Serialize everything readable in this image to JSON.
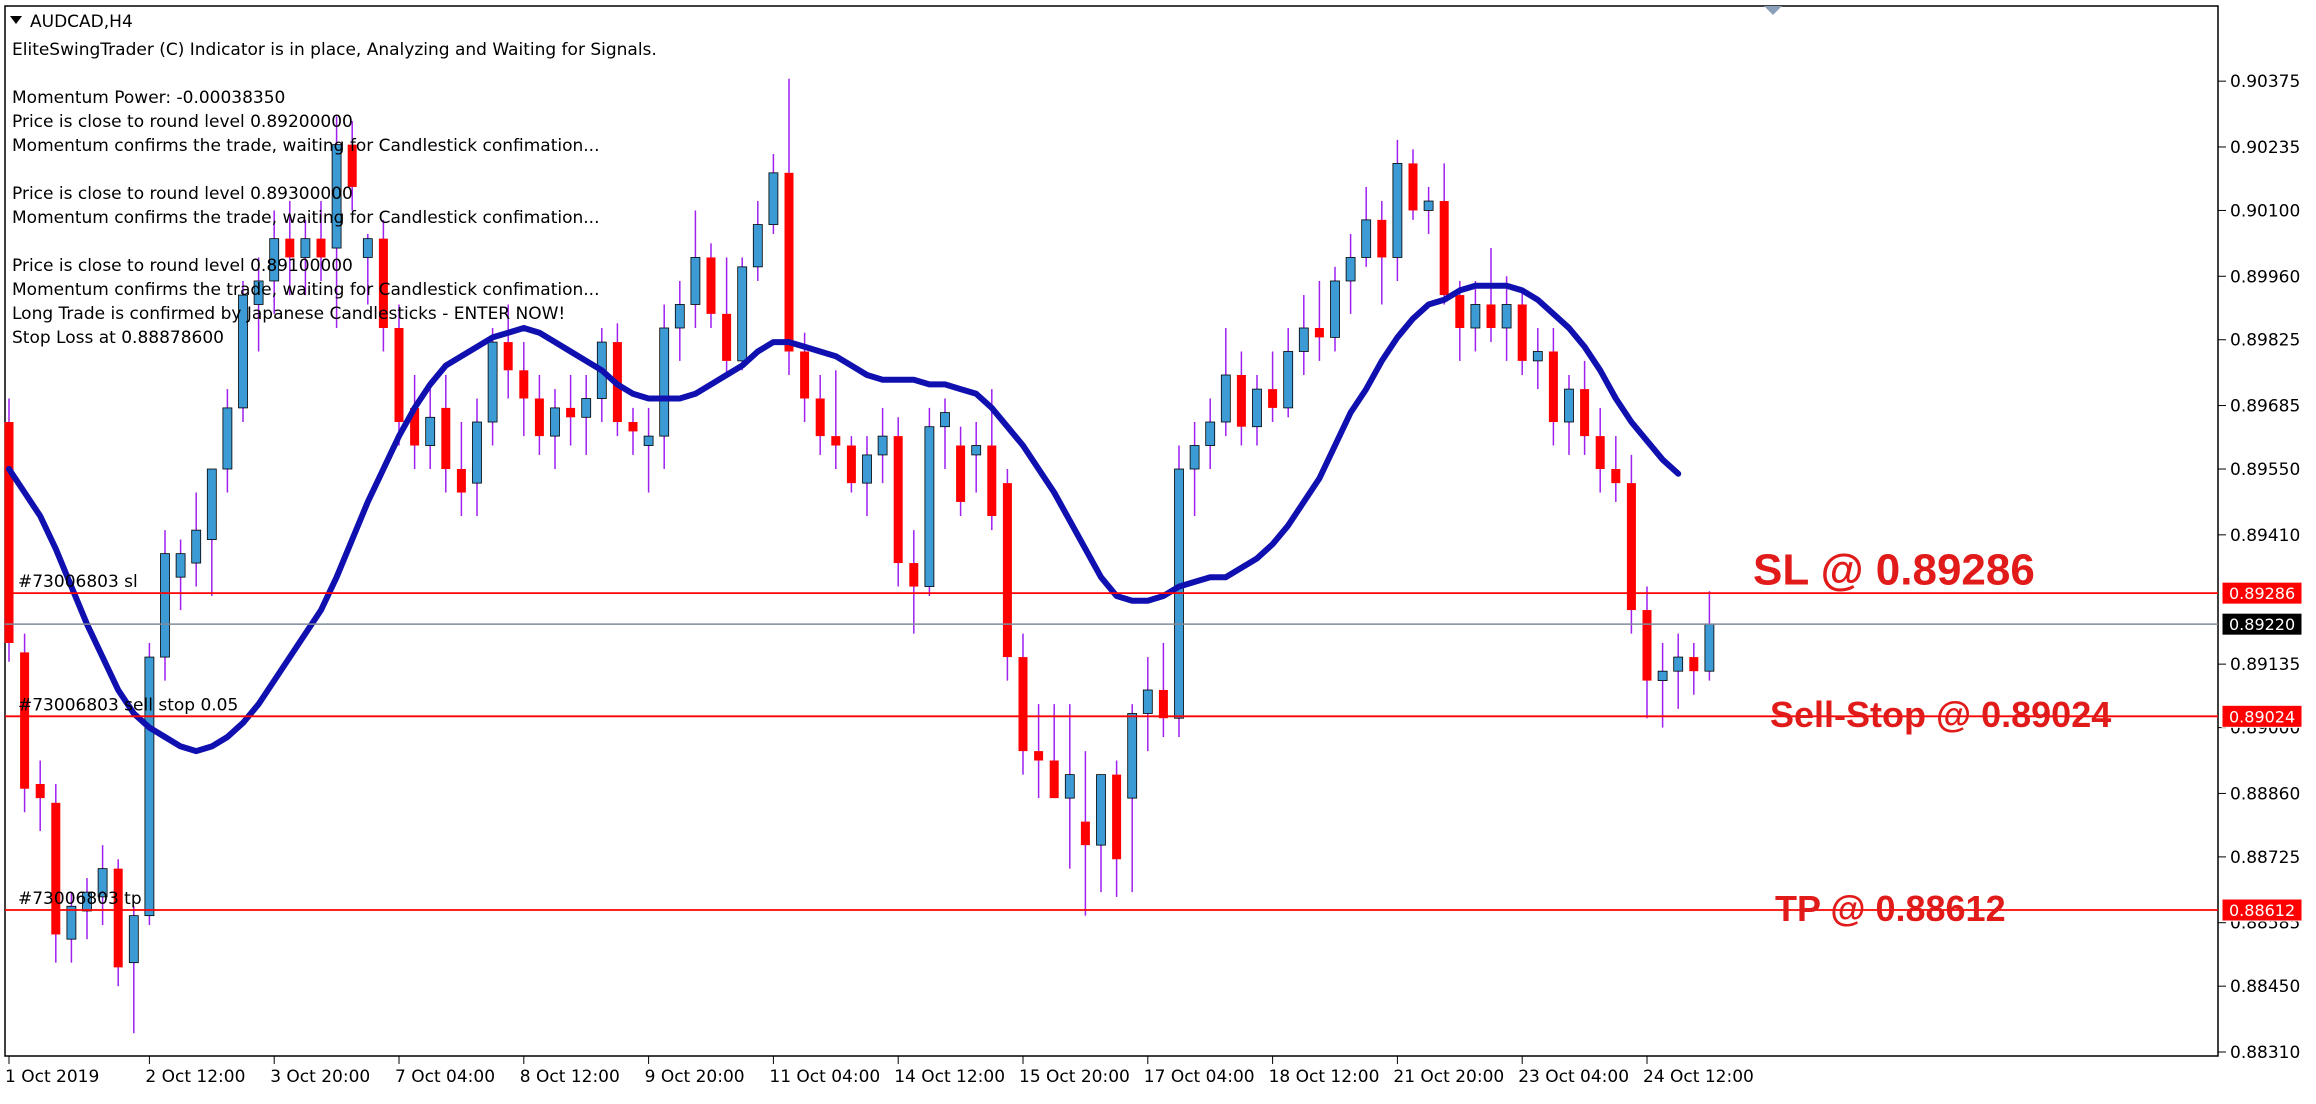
{
  "window": {
    "symbol_title": "AUDCAD,H4",
    "dropdown_icon": "triangle-down-icon",
    "scroll_marker_icon": "chart-shift-marker-icon"
  },
  "indicator": {
    "lines": [
      "EliteSwingTrader (C) Indicator is in place, Analyzing and Waiting for Signals.",
      "",
      "Momentum Power: -0.00038350",
      "Price is close to round level 0.89200000",
      "Momentum confirms the trade, waiting for Candlestick confimation...",
      "",
      "Price is close to round level 0.89300000",
      "Momentum confirms the trade, waiting for Candlestick confimation...",
      "",
      "Price is close to round level 0.89100000",
      "Momentum confirms the trade, waiting for Candlestick confimation...",
      "Long Trade is confirmed by Japanese Candlesticks - ENTER NOW!",
      "Stop Loss at 0.88878600"
    ]
  },
  "trade_levels": {
    "sl": {
      "price": 0.89286,
      "box_label": "0.89286",
      "chart_label": "#73006803 sl",
      "big_label": "SL @ 0.89286",
      "color": "#ff0000"
    },
    "entry": {
      "price": 0.89024,
      "box_label": "0.89024",
      "chart_label": "#73006803 sell stop 0.05",
      "big_label": "Sell-Stop @ 0.89024",
      "color": "#ff0000"
    },
    "tp": {
      "price": 0.88612,
      "box_label": "0.88612",
      "chart_label": "#73006803 tp",
      "big_label": "TP @ 0.88612",
      "color": "#ff0000"
    },
    "current": {
      "price": 0.8922,
      "box_label": "0.89220",
      "color": "#000000"
    }
  },
  "colors": {
    "bull_candle": "#3c9bd4",
    "bear_candle": "#ff0000",
    "wick": "#a020f0",
    "moving_average": "#1010b0",
    "level_line": "#ff0000",
    "current_line": "#808a9a",
    "big_label": "#e11a1a"
  },
  "chart_data": {
    "type": "candlestick",
    "symbol": "AUDCAD",
    "timeframe": "H4",
    "ylim": [
      0.8831,
      0.9042
    ],
    "price_ticks": [
      "0.90375",
      "0.90235",
      "0.90100",
      "0.89960",
      "0.89825",
      "0.89685",
      "0.89550",
      "0.89410",
      "0.89135",
      "0.89000",
      "0.88860",
      "0.88725",
      "0.88585",
      "0.88450",
      "0.88310"
    ],
    "time_ticks": [
      {
        "label": "1 Oct 2019",
        "bar": 0
      },
      {
        "label": "2 Oct 12:00",
        "bar": 9
      },
      {
        "label": "3 Oct 20:00",
        "bar": 17
      },
      {
        "label": "7 Oct 04:00",
        "bar": 25
      },
      {
        "label": "8 Oct 12:00",
        "bar": 33
      },
      {
        "label": "9 Oct 20:00",
        "bar": 41
      },
      {
        "label": "11 Oct 04:00",
        "bar": 49
      },
      {
        "label": "14 Oct 12:00",
        "bar": 57
      },
      {
        "label": "15 Oct 20:00",
        "bar": 65
      },
      {
        "label": "17 Oct 04:00",
        "bar": 73
      },
      {
        "label": "18 Oct 12:00",
        "bar": 81
      },
      {
        "label": "21 Oct 20:00",
        "bar": 89
      },
      {
        "label": "23 Oct 04:00",
        "bar": 97
      },
      {
        "label": "24 Oct 12:00",
        "bar": 105
      }
    ],
    "candles": [
      {
        "o": 0.8965,
        "h": 0.897,
        "l": 0.8914,
        "c": 0.8918
      },
      {
        "o": 0.8916,
        "h": 0.892,
        "l": 0.8882,
        "c": 0.8887
      },
      {
        "o": 0.8888,
        "h": 0.8893,
        "l": 0.8878,
        "c": 0.8885
      },
      {
        "o": 0.8884,
        "h": 0.8888,
        "l": 0.885,
        "c": 0.8856
      },
      {
        "o": 0.8855,
        "h": 0.8865,
        "l": 0.885,
        "c": 0.8862
      },
      {
        "o": 0.8861,
        "h": 0.8868,
        "l": 0.8855,
        "c": 0.8865
      },
      {
        "o": 0.8864,
        "h": 0.8875,
        "l": 0.8858,
        "c": 0.887
      },
      {
        "o": 0.887,
        "h": 0.8872,
        "l": 0.8845,
        "c": 0.8849
      },
      {
        "o": 0.885,
        "h": 0.8862,
        "l": 0.8835,
        "c": 0.886
      },
      {
        "o": 0.886,
        "h": 0.8918,
        "l": 0.8858,
        "c": 0.8915
      },
      {
        "o": 0.8915,
        "h": 0.8942,
        "l": 0.891,
        "c": 0.8937
      },
      {
        "o": 0.8932,
        "h": 0.894,
        "l": 0.8925,
        "c": 0.8937
      },
      {
        "o": 0.8935,
        "h": 0.895,
        "l": 0.893,
        "c": 0.8942
      },
      {
        "o": 0.894,
        "h": 0.8955,
        "l": 0.8928,
        "c": 0.8955
      },
      {
        "o": 0.8955,
        "h": 0.8972,
        "l": 0.895,
        "c": 0.8968
      },
      {
        "o": 0.8968,
        "h": 0.8995,
        "l": 0.8965,
        "c": 0.8992
      },
      {
        "o": 0.899,
        "h": 0.9,
        "l": 0.898,
        "c": 0.8995
      },
      {
        "o": 0.8995,
        "h": 0.901,
        "l": 0.8988,
        "c": 0.9004
      },
      {
        "o": 0.9004,
        "h": 0.9012,
        "l": 0.8992,
        "c": 0.9
      },
      {
        "o": 0.9,
        "h": 0.9008,
        "l": 0.8992,
        "c": 0.9004
      },
      {
        "o": 0.9004,
        "h": 0.9012,
        "l": 0.8995,
        "c": 0.9
      },
      {
        "o": 0.9002,
        "h": 0.903,
        "l": 0.8985,
        "c": 0.9024
      },
      {
        "o": 0.9024,
        "h": 0.9029,
        "l": 0.901,
        "c": 0.9015
      },
      {
        "o": 0.9,
        "h": 0.9005,
        "l": 0.899,
        "c": 0.9004
      },
      {
        "o": 0.9004,
        "h": 0.9008,
        "l": 0.898,
        "c": 0.8985
      },
      {
        "o": 0.8985,
        "h": 0.899,
        "l": 0.896,
        "c": 0.8965
      },
      {
        "o": 0.8968,
        "h": 0.8975,
        "l": 0.8955,
        "c": 0.896
      },
      {
        "o": 0.896,
        "h": 0.8972,
        "l": 0.8955,
        "c": 0.8966
      },
      {
        "o": 0.8968,
        "h": 0.8975,
        "l": 0.895,
        "c": 0.8955
      },
      {
        "o": 0.8955,
        "h": 0.8965,
        "l": 0.8945,
        "c": 0.895
      },
      {
        "o": 0.8952,
        "h": 0.897,
        "l": 0.8945,
        "c": 0.8965
      },
      {
        "o": 0.8965,
        "h": 0.8985,
        "l": 0.896,
        "c": 0.8982
      },
      {
        "o": 0.8982,
        "h": 0.899,
        "l": 0.897,
        "c": 0.8976
      },
      {
        "o": 0.8976,
        "h": 0.8982,
        "l": 0.8962,
        "c": 0.897
      },
      {
        "o": 0.897,
        "h": 0.8975,
        "l": 0.8958,
        "c": 0.8962
      },
      {
        "o": 0.8962,
        "h": 0.8972,
        "l": 0.8955,
        "c": 0.8968
      },
      {
        "o": 0.8968,
        "h": 0.8975,
        "l": 0.896,
        "c": 0.8966
      },
      {
        "o": 0.8966,
        "h": 0.8975,
        "l": 0.8958,
        "c": 0.897
      },
      {
        "o": 0.897,
        "h": 0.8985,
        "l": 0.8965,
        "c": 0.8982
      },
      {
        "o": 0.8982,
        "h": 0.8986,
        "l": 0.8962,
        "c": 0.8965
      },
      {
        "o": 0.8965,
        "h": 0.8968,
        "l": 0.8958,
        "c": 0.8963
      },
      {
        "o": 0.896,
        "h": 0.8968,
        "l": 0.895,
        "c": 0.8962
      },
      {
        "o": 0.8962,
        "h": 0.899,
        "l": 0.8955,
        "c": 0.8985
      },
      {
        "o": 0.8985,
        "h": 0.8995,
        "l": 0.8978,
        "c": 0.899
      },
      {
        "o": 0.899,
        "h": 0.901,
        "l": 0.8985,
        "c": 0.9
      },
      {
        "o": 0.9,
        "h": 0.9003,
        "l": 0.8985,
        "c": 0.8988
      },
      {
        "o": 0.8988,
        "h": 0.9,
        "l": 0.8975,
        "c": 0.8978
      },
      {
        "o": 0.8978,
        "h": 0.9,
        "l": 0.8976,
        "c": 0.8998
      },
      {
        "o": 0.8998,
        "h": 0.9012,
        "l": 0.8995,
        "c": 0.9007
      },
      {
        "o": 0.9007,
        "h": 0.9022,
        "l": 0.9005,
        "c": 0.9018
      },
      {
        "o": 0.9018,
        "h": 0.9038,
        "l": 0.8975,
        "c": 0.898
      },
      {
        "o": 0.898,
        "h": 0.8984,
        "l": 0.8965,
        "c": 0.897
      },
      {
        "o": 0.897,
        "h": 0.8975,
        "l": 0.8958,
        "c": 0.8962
      },
      {
        "o": 0.8962,
        "h": 0.8976,
        "l": 0.8955,
        "c": 0.896
      },
      {
        "o": 0.896,
        "h": 0.8962,
        "l": 0.895,
        "c": 0.8952
      },
      {
        "o": 0.8952,
        "h": 0.8962,
        "l": 0.8945,
        "c": 0.8958
      },
      {
        "o": 0.8958,
        "h": 0.8968,
        "l": 0.8952,
        "c": 0.8962
      },
      {
        "o": 0.8962,
        "h": 0.8966,
        "l": 0.893,
        "c": 0.8935
      },
      {
        "o": 0.8935,
        "h": 0.8942,
        "l": 0.892,
        "c": 0.893
      },
      {
        "o": 0.893,
        "h": 0.8968,
        "l": 0.8928,
        "c": 0.8964
      },
      {
        "o": 0.8964,
        "h": 0.897,
        "l": 0.8955,
        "c": 0.8967
      },
      {
        "o": 0.896,
        "h": 0.8964,
        "l": 0.8945,
        "c": 0.8948
      },
      {
        "o": 0.8958,
        "h": 0.8965,
        "l": 0.895,
        "c": 0.896
      },
      {
        "o": 0.896,
        "h": 0.8972,
        "l": 0.8942,
        "c": 0.8945
      },
      {
        "o": 0.8952,
        "h": 0.8955,
        "l": 0.891,
        "c": 0.8915
      },
      {
        "o": 0.8915,
        "h": 0.892,
        "l": 0.889,
        "c": 0.8895
      },
      {
        "o": 0.8895,
        "h": 0.8905,
        "l": 0.8885,
        "c": 0.8893
      },
      {
        "o": 0.8893,
        "h": 0.8905,
        "l": 0.8885,
        "c": 0.8885
      },
      {
        "o": 0.8885,
        "h": 0.8905,
        "l": 0.887,
        "c": 0.889
      },
      {
        "o": 0.888,
        "h": 0.8895,
        "l": 0.886,
        "c": 0.8875
      },
      {
        "o": 0.8875,
        "h": 0.889,
        "l": 0.8865,
        "c": 0.889
      },
      {
        "o": 0.889,
        "h": 0.8893,
        "l": 0.8864,
        "c": 0.8872
      },
      {
        "o": 0.8885,
        "h": 0.8905,
        "l": 0.8865,
        "c": 0.8903
      },
      {
        "o": 0.8903,
        "h": 0.8915,
        "l": 0.8895,
        "c": 0.8908
      },
      {
        "o": 0.8908,
        "h": 0.8918,
        "l": 0.8898,
        "c": 0.8902
      },
      {
        "o": 0.8902,
        "h": 0.896,
        "l": 0.8898,
        "c": 0.8955
      },
      {
        "o": 0.8955,
        "h": 0.8965,
        "l": 0.8945,
        "c": 0.896
      },
      {
        "o": 0.896,
        "h": 0.897,
        "l": 0.8955,
        "c": 0.8965
      },
      {
        "o": 0.8965,
        "h": 0.8985,
        "l": 0.8962,
        "c": 0.8975
      },
      {
        "o": 0.8975,
        "h": 0.898,
        "l": 0.896,
        "c": 0.8964
      },
      {
        "o": 0.8964,
        "h": 0.8975,
        "l": 0.896,
        "c": 0.8972
      },
      {
        "o": 0.8972,
        "h": 0.898,
        "l": 0.8965,
        "c": 0.8968
      },
      {
        "o": 0.8968,
        "h": 0.8985,
        "l": 0.8966,
        "c": 0.898
      },
      {
        "o": 0.898,
        "h": 0.8992,
        "l": 0.8975,
        "c": 0.8985
      },
      {
        "o": 0.8985,
        "h": 0.8995,
        "l": 0.8978,
        "c": 0.8983
      },
      {
        "o": 0.8983,
        "h": 0.8998,
        "l": 0.898,
        "c": 0.8995
      },
      {
        "o": 0.8995,
        "h": 0.9005,
        "l": 0.8988,
        "c": 0.9
      },
      {
        "o": 0.9,
        "h": 0.9015,
        "l": 0.8998,
        "c": 0.9008
      },
      {
        "o": 0.9008,
        "h": 0.9012,
        "l": 0.899,
        "c": 0.9
      },
      {
        "o": 0.9,
        "h": 0.9025,
        "l": 0.8995,
        "c": 0.902
      },
      {
        "o": 0.902,
        "h": 0.9023,
        "l": 0.9008,
        "c": 0.901
      },
      {
        "o": 0.901,
        "h": 0.9015,
        "l": 0.9005,
        "c": 0.9012
      },
      {
        "o": 0.9012,
        "h": 0.902,
        "l": 0.899,
        "c": 0.8992
      },
      {
        "o": 0.8992,
        "h": 0.8995,
        "l": 0.8978,
        "c": 0.8985
      },
      {
        "o": 0.8985,
        "h": 0.8995,
        "l": 0.898,
        "c": 0.899
      },
      {
        "o": 0.899,
        "h": 0.9002,
        "l": 0.8982,
        "c": 0.8985
      },
      {
        "o": 0.8985,
        "h": 0.8996,
        "l": 0.8978,
        "c": 0.899
      },
      {
        "o": 0.899,
        "h": 0.8993,
        "l": 0.8975,
        "c": 0.8978
      },
      {
        "o": 0.8978,
        "h": 0.8985,
        "l": 0.8972,
        "c": 0.898
      },
      {
        "o": 0.898,
        "h": 0.8985,
        "l": 0.896,
        "c": 0.8965
      },
      {
        "o": 0.8965,
        "h": 0.8975,
        "l": 0.8958,
        "c": 0.8972
      },
      {
        "o": 0.8972,
        "h": 0.8978,
        "l": 0.8958,
        "c": 0.8962
      },
      {
        "o": 0.8962,
        "h": 0.8968,
        "l": 0.895,
        "c": 0.8955
      },
      {
        "o": 0.8955,
        "h": 0.8962,
        "l": 0.8948,
        "c": 0.8952
      },
      {
        "o": 0.8952,
        "h": 0.8958,
        "l": 0.892,
        "c": 0.8925
      },
      {
        "o": 0.8925,
        "h": 0.893,
        "l": 0.8902,
        "c": 0.891
      },
      {
        "o": 0.891,
        "h": 0.8918,
        "l": 0.89,
        "c": 0.8912
      },
      {
        "o": 0.8912,
        "h": 0.892,
        "l": 0.8904,
        "c": 0.8915
      },
      {
        "o": 0.8915,
        "h": 0.8918,
        "l": 0.8907,
        "c": 0.8912
      },
      {
        "o": 0.8912,
        "h": 0.8929,
        "l": 0.891,
        "c": 0.8922
      }
    ],
    "moving_average": [
      0.8955,
      0.895,
      0.8945,
      0.8938,
      0.893,
      0.8922,
      0.8915,
      0.8908,
      0.8903,
      0.89,
      0.8898,
      0.8896,
      0.8895,
      0.8896,
      0.8898,
      0.8901,
      0.8905,
      0.891,
      0.8915,
      0.892,
      0.8925,
      0.8932,
      0.894,
      0.8948,
      0.8955,
      0.8962,
      0.8968,
      0.8973,
      0.8977,
      0.8979,
      0.8981,
      0.8983,
      0.8984,
      0.8985,
      0.8984,
      0.8982,
      0.898,
      0.8978,
      0.8976,
      0.8973,
      0.8971,
      0.897,
      0.897,
      0.897,
      0.8971,
      0.8973,
      0.8975,
      0.8977,
      0.898,
      0.8982,
      0.8982,
      0.8981,
      0.898,
      0.8979,
      0.8977,
      0.8975,
      0.8974,
      0.8974,
      0.8974,
      0.8973,
      0.8973,
      0.8972,
      0.8971,
      0.8968,
      0.8964,
      0.896,
      0.8955,
      0.895,
      0.8944,
      0.8938,
      0.8932,
      0.8928,
      0.8927,
      0.8927,
      0.8928,
      0.893,
      0.8931,
      0.8932,
      0.8932,
      0.8934,
      0.8936,
      0.8939,
      0.8943,
      0.8948,
      0.8953,
      0.896,
      0.8967,
      0.8972,
      0.8978,
      0.8983,
      0.8987,
      0.899,
      0.8991,
      0.8993,
      0.8994,
      0.8994,
      0.8994,
      0.8993,
      0.8991,
      0.8988,
      0.8985,
      0.8981,
      0.8976,
      0.897,
      0.8965,
      0.8961,
      0.8957,
      0.8954
    ]
  }
}
